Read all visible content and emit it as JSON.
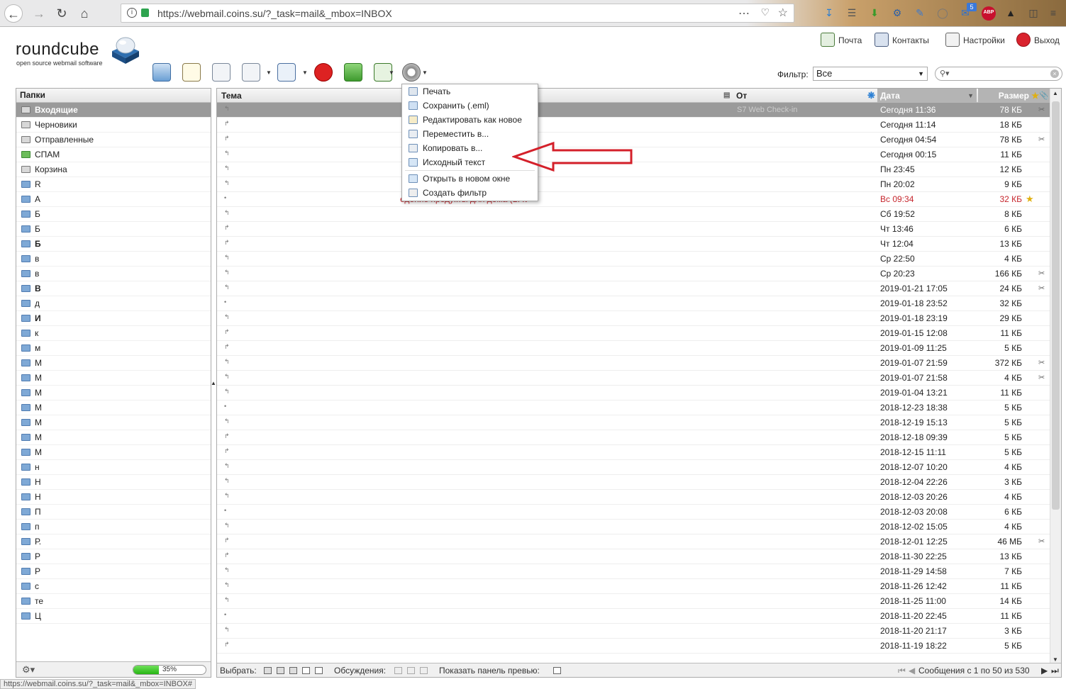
{
  "browser": {
    "url": "https://webmail.coins.su/?_task=mail&_mbox=INBOX",
    "ext_badge": "5",
    "abp_label": "ABP",
    "status_url": "https://webmail.coins.su/?_task=mail&_mbox=INBOX#"
  },
  "app": {
    "logo_text": "roundcube",
    "logo_sub": "open source webmail software"
  },
  "topnav": [
    {
      "label": "Почта",
      "icon": "mail-icon"
    },
    {
      "label": "Контакты",
      "icon": "contacts-icon"
    },
    {
      "label": "Настройки",
      "icon": "settings-icon"
    },
    {
      "label": "Выход",
      "icon": "logout-icon"
    }
  ],
  "toolbar": {
    "buttons": [
      "refresh-icon",
      "compose-icon",
      "reply-icon",
      "reply-all-icon",
      "forward-icon",
      "delete-icon",
      "spam-icon",
      "mark-icon",
      "more-icon"
    ]
  },
  "filter": {
    "label": "Фильтр:",
    "value": "Все"
  },
  "folders": {
    "header": "Папки",
    "items": [
      {
        "label": "Входящие",
        "type": "inbox",
        "selected": true
      },
      {
        "label": "Черновики",
        "type": "drafts"
      },
      {
        "label": "Отправленные",
        "type": "sent"
      },
      {
        "label": "СПАМ",
        "type": "spam"
      },
      {
        "label": "Корзина",
        "type": "trash"
      },
      {
        "label": "R"
      },
      {
        "label": "A"
      },
      {
        "label": "Б"
      },
      {
        "label": "Б"
      },
      {
        "label": "Б",
        "bold": true
      },
      {
        "label": "в"
      },
      {
        "label": "в"
      },
      {
        "label": "В",
        "bold": true
      },
      {
        "label": "д"
      },
      {
        "label": "И",
        "bold": true
      },
      {
        "label": "к"
      },
      {
        "label": "м"
      },
      {
        "label": "М"
      },
      {
        "label": "М"
      },
      {
        "label": "М"
      },
      {
        "label": "М"
      },
      {
        "label": "М"
      },
      {
        "label": "М"
      },
      {
        "label": "М"
      },
      {
        "label": "н"
      },
      {
        "label": "Н"
      },
      {
        "label": "Н"
      },
      {
        "label": "П"
      },
      {
        "label": "п"
      },
      {
        "label": "Р."
      },
      {
        "label": "Р"
      },
      {
        "label": "Р"
      },
      {
        "label": "с"
      },
      {
        "label": "те"
      },
      {
        "label": "Ц"
      }
    ],
    "quota_percent": 35,
    "quota_text": "35%"
  },
  "messages": {
    "columns": {
      "subject": "Тема",
      "from": "От",
      "date": "Дата",
      "size": "Размер"
    },
    "first_from_fragment": "S7 Web Check-in",
    "subject_fragment": "едение продукты для дома (BAV",
    "rows": [
      {
        "date": "Сегодня 11:36",
        "size": "78 КБ",
        "attach": true,
        "selected": true
      },
      {
        "date": "Сегодня 11:14",
        "size": "18 КБ"
      },
      {
        "date": "Сегодня 04:54",
        "size": "78 КБ",
        "attach": true
      },
      {
        "date": "Сегодня 00:15",
        "size": "11 КБ"
      },
      {
        "date": "Пн 23:45",
        "size": "12 КБ"
      },
      {
        "date": "Пн 20:02",
        "size": "9 КБ"
      },
      {
        "date": "Вс 09:34",
        "size": "32 КБ",
        "flagged": true
      },
      {
        "date": "Сб 19:52",
        "size": "8 КБ"
      },
      {
        "date": "Чт 13:46",
        "size": "6 КБ"
      },
      {
        "date": "Чт 12:04",
        "size": "13 КБ"
      },
      {
        "date": "Ср 22:50",
        "size": "4 КБ"
      },
      {
        "date": "Ср 20:23",
        "size": "166 КБ",
        "attach": true
      },
      {
        "date": "2019-01-21 17:05",
        "size": "24 КБ",
        "attach": true
      },
      {
        "date": "2019-01-18 23:52",
        "size": "32 КБ"
      },
      {
        "date": "2019-01-18 23:19",
        "size": "29 КБ"
      },
      {
        "date": "2019-01-15 12:08",
        "size": "11 КБ"
      },
      {
        "date": "2019-01-09 11:25",
        "size": "5 КБ"
      },
      {
        "date": "2019-01-07 21:59",
        "size": "372 КБ",
        "attach": true
      },
      {
        "date": "2019-01-07 21:58",
        "size": "4 КБ",
        "attach": true
      },
      {
        "date": "2019-01-04 13:21",
        "size": "11 КБ"
      },
      {
        "date": "2018-12-23 18:38",
        "size": "5 КБ"
      },
      {
        "date": "2018-12-19 15:13",
        "size": "5 КБ"
      },
      {
        "date": "2018-12-18 09:39",
        "size": "5 КБ"
      },
      {
        "date": "2018-12-15 11:11",
        "size": "5 КБ"
      },
      {
        "date": "2018-12-07 10:20",
        "size": "4 КБ"
      },
      {
        "date": "2018-12-04 22:26",
        "size": "3 КБ"
      },
      {
        "date": "2018-12-03 20:26",
        "size": "4 КБ"
      },
      {
        "date": "2018-12-03 20:08",
        "size": "6 КБ"
      },
      {
        "date": "2018-12-02 15:05",
        "size": "4 КБ"
      },
      {
        "date": "2018-12-01 12:25",
        "size": "46 МБ",
        "attach": true
      },
      {
        "date": "2018-11-30 22:25",
        "size": "13 КБ"
      },
      {
        "date": "2018-11-29 14:58",
        "size": "7 КБ"
      },
      {
        "date": "2018-11-26 12:42",
        "size": "11 КБ"
      },
      {
        "date": "2018-11-25 11:00",
        "size": "14 КБ"
      },
      {
        "date": "2018-11-20 22:45",
        "size": "11 КБ"
      },
      {
        "date": "2018-11-20 21:17",
        "size": "3 КБ"
      },
      {
        "date": "2018-11-19 18:22",
        "size": "5 КБ"
      }
    ]
  },
  "footer": {
    "select_label": "Выбрать:",
    "threads_label": "Обсуждения:",
    "preview_label": "Показать панель превью:",
    "count_text": "Сообщения с 1 по 50 из 530"
  },
  "context_menu": {
    "items": [
      {
        "label": "Печать",
        "icon": "print-icon"
      },
      {
        "label": "Сохранить (.eml)",
        "icon": "save-icon"
      },
      {
        "label": "Редактировать как новое",
        "icon": "edit-icon"
      },
      {
        "label": "Переместить в...",
        "icon": "move-icon"
      },
      {
        "label": "Копировать в...",
        "icon": "copy-icon"
      },
      {
        "label": "Исходный текст",
        "icon": "source-icon"
      },
      {
        "label": "Открыть в новом окне",
        "icon": "new-window-icon",
        "sep_before": true
      },
      {
        "label": "Создать фильтр",
        "icon": "filter-icon"
      }
    ]
  },
  "colors": {
    "selected_row": "#9a9a9a",
    "flagged": "#c6262d",
    "annotation": "#d4202a",
    "quota": "#27b514"
  }
}
